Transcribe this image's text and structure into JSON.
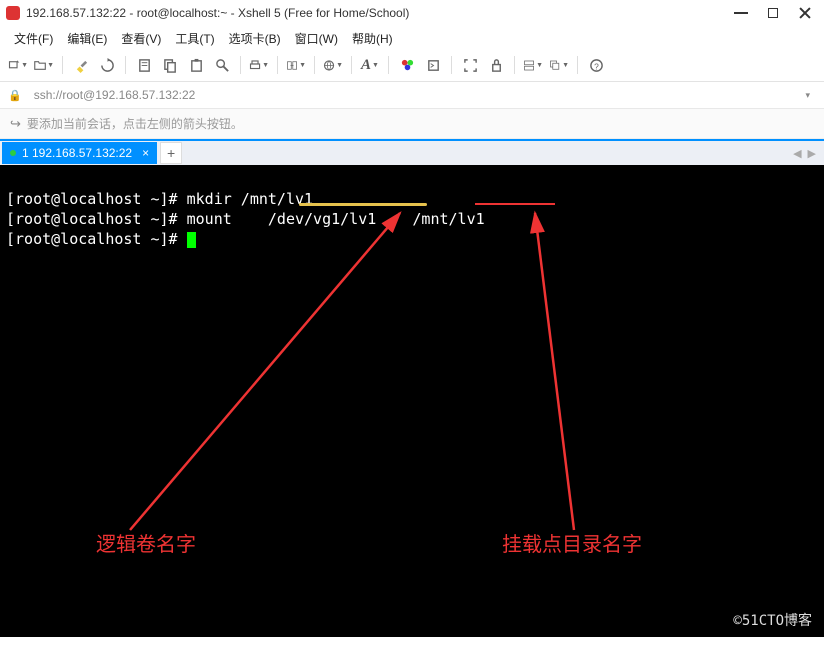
{
  "window": {
    "title": "192.168.57.132:22 - root@localhost:~ - Xshell 5 (Free for Home/School)"
  },
  "menu": {
    "file": "文件(F)",
    "edit": "编辑(E)",
    "view": "查看(V)",
    "tools": "工具(T)",
    "tabs": "选项卡(B)",
    "window": "窗口(W)",
    "help": "帮助(H)"
  },
  "address": {
    "text": "ssh://root@192.168.57.132:22"
  },
  "hint": {
    "text": "要添加当前会话，点击左侧的箭头按钮。"
  },
  "tab": {
    "label": "1 192.168.57.132:22"
  },
  "term": {
    "l1a": "[root@localhost ~]# ",
    "l1b": "mkdir /mnt/lv1",
    "l2a": "[root@localhost ~]# ",
    "l2b": "mount",
    "l2c": "/dev/vg1/lv1",
    "l2d": "/mnt/lv1",
    "l3a": "[root@localhost ~]# "
  },
  "annotations": {
    "lv_name": "逻辑卷名字",
    "mount_name": "挂载点目录名字"
  },
  "watermark": "©51CTO博客"
}
